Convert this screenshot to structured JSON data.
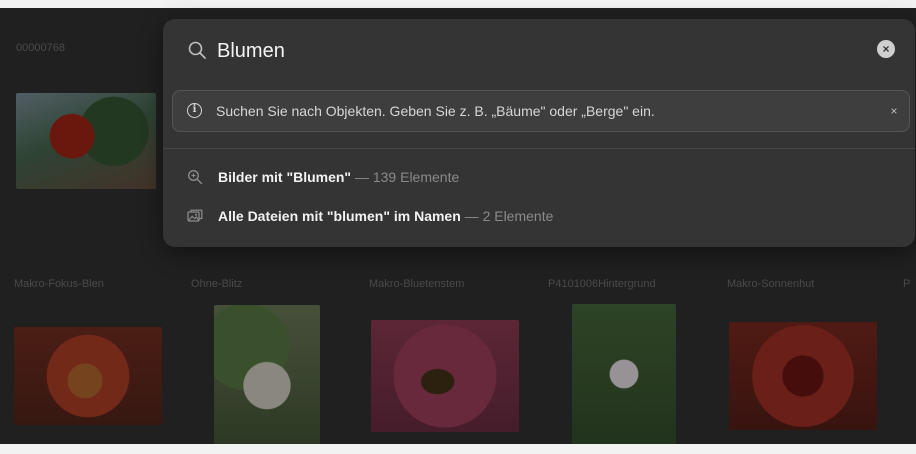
{
  "search": {
    "query": "Blumen"
  },
  "hint": {
    "text": "Suchen Sie nach Objekten. Geben Sie z. B. „Bäume\" oder „Berge\" ein.",
    "close_glyph": "×",
    "info_glyph": "i"
  },
  "clear_glyph": "×",
  "results": [
    {
      "icon": "zoom-search-icon",
      "label": "Bilder mit \"Blumen\"",
      "separator": " — ",
      "count": "139 Elemente"
    },
    {
      "icon": "photo-stack-icon",
      "label": "Alle Dateien mit \"blumen\" im Namen",
      "separator": " — ",
      "count": "2 Elemente"
    }
  ],
  "background": {
    "top_label": "00000768",
    "thumbnail_labels": [
      "Makro-Fokus-Blen",
      "Ohne-Blitz",
      "Makro-Bluetenstem",
      "P4101006Hintergrund",
      "Makro-Sonnenhut",
      "P"
    ]
  },
  "colors": {
    "panel": "#343434",
    "background": "#202020",
    "text_primary": "#f2f2f2",
    "text_muted": "#8a8a8a"
  }
}
